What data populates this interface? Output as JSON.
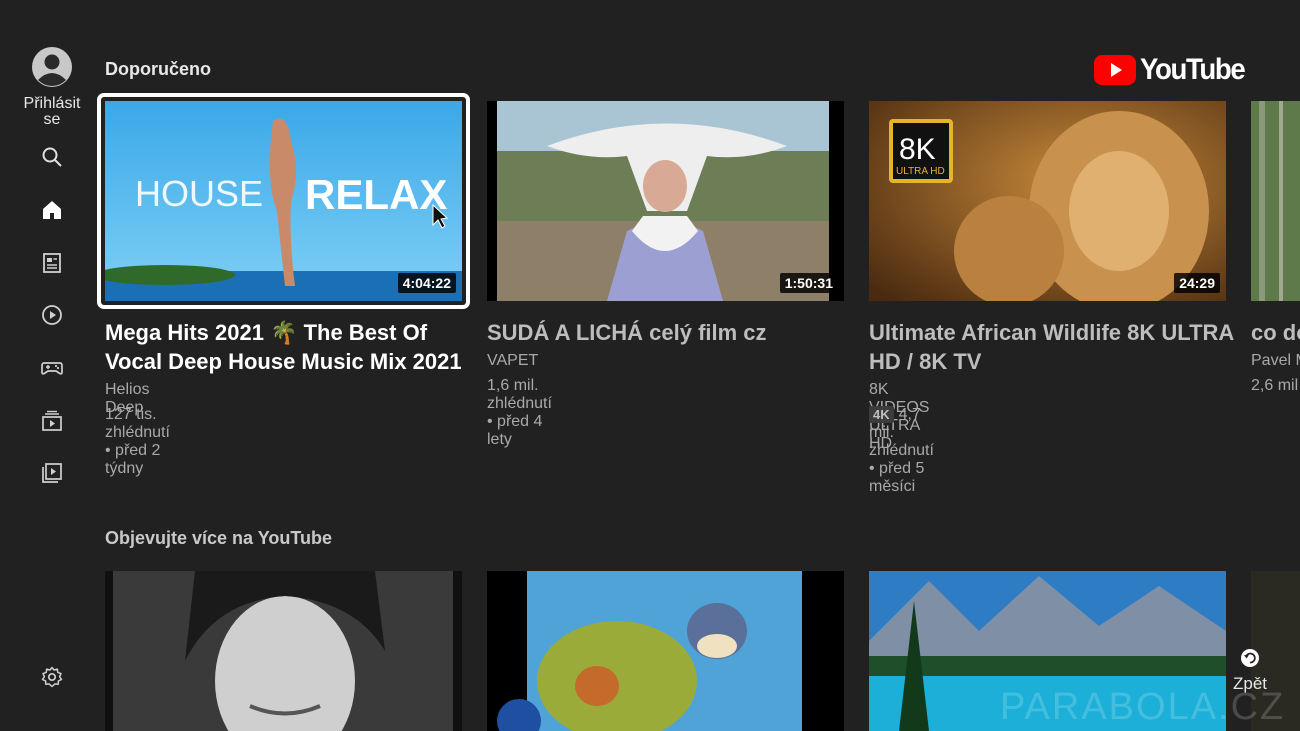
{
  "sidebar": {
    "signin_label": "Přihlásit se",
    "icons": [
      "search-icon",
      "home-icon",
      "subscriptions-icon",
      "library-icon",
      "gaming-icon",
      "queue-icon",
      "playlists-icon",
      "settings-icon"
    ]
  },
  "logo": {
    "text": "YouTube",
    "color": "#ff0000"
  },
  "rows": [
    {
      "title": "Doporučeno",
      "videos": [
        {
          "title": "Mega Hits 2021 🌴 The Best Of Vocal Deep House Music Mix 2021",
          "channel": "Helios Deep",
          "meta": "127 tis. zhlédnutí • před 2 týdny",
          "duration": "4:04:22",
          "thumb_text_a": "HOUSE",
          "thumb_text_b": "RELAX",
          "focused": true
        },
        {
          "title": "SUDÁ A LICHÁ celý film cz",
          "channel": "VAPET",
          "meta": "1,6 mil. zhlédnutí • před 4 lety",
          "duration": "1:50:31"
        },
        {
          "title": "Ultimate African Wildlife 8K ULTRA HD / 8K TV",
          "channel": "8K VIDEOS ULTRA HD",
          "badge": "4K",
          "meta": "4,7 mil. zhlédnutí • před 5 měsíci",
          "duration": "24:29",
          "thumb_badge_main": "8K",
          "thumb_badge_sub": "ULTRA HD"
        },
        {
          "title": "co do",
          "channel": "Pavel M",
          "meta": "2,6 mil"
        }
      ]
    },
    {
      "title": "Objevujte více na YouTube"
    }
  ],
  "back_label": "Zpět",
  "watermark": "PARABOLA.CZ"
}
